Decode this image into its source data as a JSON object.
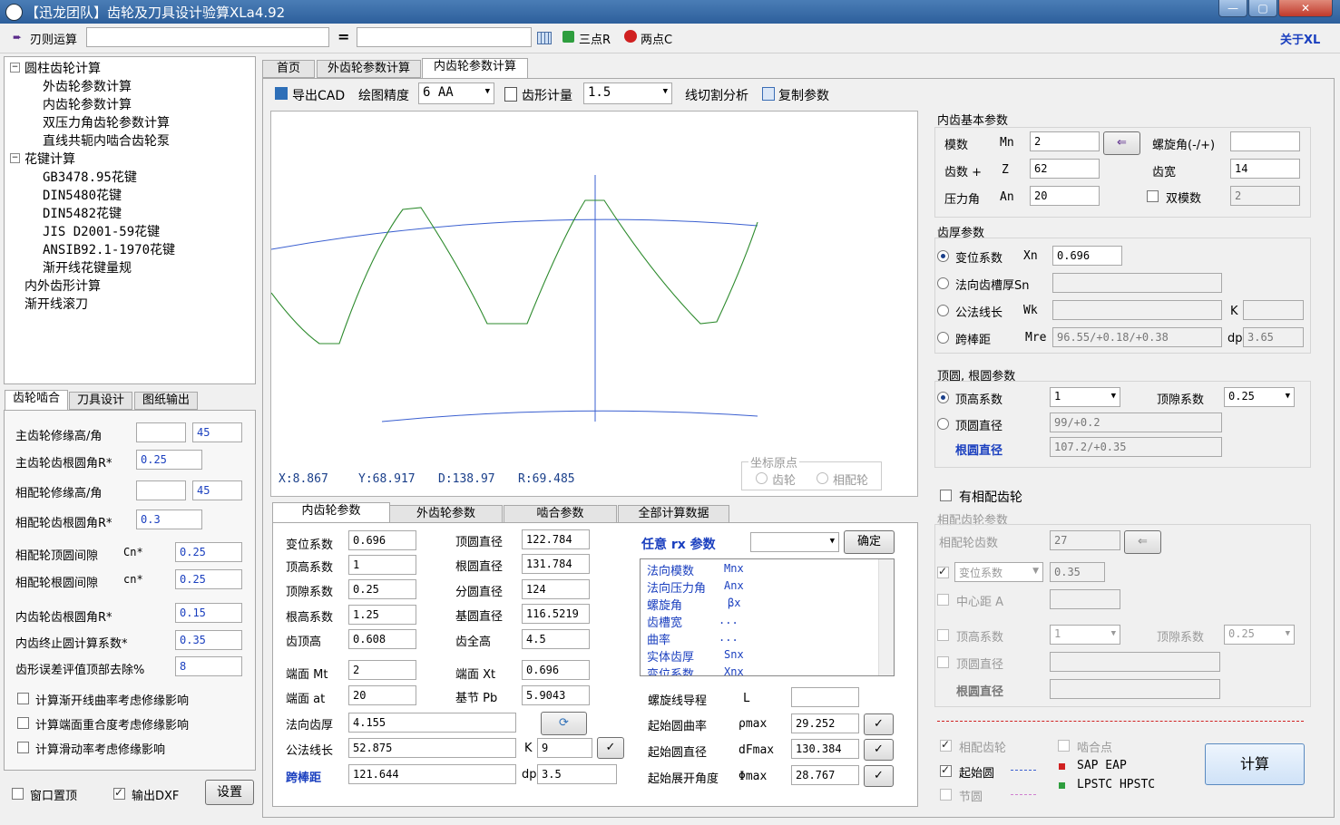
{
  "title": "【迅龙团队】齿轮及刀具设计验算XLa4.92",
  "window_buttons": {
    "min": "—",
    "max": "▢",
    "close": "✕"
  },
  "toolbar": {
    "rule_calc_label": "刃则运算",
    "eq": "=",
    "three_point": "三点R",
    "two_point": "两点C",
    "about": "关于XL"
  },
  "tree": {
    "items": [
      "圆柱齿轮计算",
      "外齿轮参数计算",
      "内齿轮参数计算",
      "双压力角齿轮参数计算",
      "直线共轭内啮合齿轮泵",
      "花键计算",
      "GB3478.95花键",
      "DIN5480花键",
      "DIN5482花键",
      "JIS D2001-59花键",
      "ANSIB92.1-1970花键",
      "渐开线花键量规",
      "内外齿形计算",
      "渐开线滚刀"
    ]
  },
  "left_tabs": [
    "齿轮啮合",
    "刀具设计",
    "图纸输出"
  ],
  "left_form": {
    "rows": [
      {
        "label": "主齿轮修缘高/角",
        "v1": "",
        "v2": "45"
      },
      {
        "label": "主齿轮齿根圆角R*",
        "v1": "0.25"
      },
      {
        "label": "相配轮修缘高/角",
        "v1": "",
        "v2": "45"
      },
      {
        "label": "相配轮齿根圆角R*",
        "v1": "0.3"
      },
      {
        "label": "相配轮顶圆间隙",
        "sym": "Cn*",
        "v1": "0.25"
      },
      {
        "label": "相配轮根圆间隙",
        "sym": "cn*",
        "v1": "0.25"
      },
      {
        "label": "内齿轮齿根圆角R*",
        "v1": "0.15"
      },
      {
        "label": "内齿终止圆计算系数*",
        "v1": "0.35"
      },
      {
        "label": "齿形误差评值顶部去除%",
        "v1": "8"
      }
    ],
    "checks": [
      "计算渐开线曲率考虑修缘影响",
      "计算端面重合度考虑修缘影响",
      "计算滑动率考虑修缘影响"
    ],
    "bottom": {
      "topmost": "窗口置顶",
      "dxf": "输出DXF",
      "settings": "设置"
    }
  },
  "main_tabs": [
    "首页",
    "外齿轮参数计算",
    "内齿轮参数计算"
  ],
  "drawbar": {
    "export_cad": "导出CAD",
    "precision_label": "绘图精度",
    "precision_value": "6  AA",
    "gauge_label": "齿形计量",
    "gauge_value": "1.5",
    "wire_cut": "线切割分析",
    "copy_params": "复制参数"
  },
  "canvas": {
    "x": "X:8.867",
    "y": "Y:68.917",
    "d": "D:138.97",
    "r": "R:69.485",
    "origin_title": "坐标原点",
    "origin_gear": "齿轮",
    "origin_mate": "相配轮"
  },
  "bottom_tabs": [
    "内齿轮参数",
    "外齿轮参数",
    "啮合参数",
    "全部计算数据"
  ],
  "inner_params": {
    "col1": [
      {
        "label": "变位系数",
        "value": "0.696"
      },
      {
        "label": "顶高系数",
        "value": "1"
      },
      {
        "label": "顶隙系数",
        "value": "0.25"
      },
      {
        "label": "根高系数",
        "value": "1.25"
      },
      {
        "label": "齿顶高",
        "value": "0.608"
      },
      {
        "label": "端面 Mt",
        "value": "2"
      },
      {
        "label": "端面 at",
        "value": "20"
      }
    ],
    "col2": [
      {
        "label": "顶圆直径",
        "value": "122.784"
      },
      {
        "label": "根圆直径",
        "value": "131.784"
      },
      {
        "label": "分圆直径",
        "value": "124"
      },
      {
        "label": "基圆直径",
        "value": "116.5219"
      },
      {
        "label": "齿全高",
        "value": "4.5"
      },
      {
        "label": "端面 Xt",
        "value": "0.696"
      },
      {
        "label": "基节 Pb",
        "value": "5.9043"
      }
    ],
    "normal_thickness_label": "法向齿厚",
    "normal_thickness": "4.155",
    "wk_label": "公法线长",
    "wk": "52.875",
    "k_label": "K",
    "k": "9",
    "ball_label": "跨棒距",
    "ball": "121.644",
    "dp_label": "dp",
    "dp": "3.5",
    "rx_title": "任意 rx 参数",
    "confirm": "确定",
    "rx_list": [
      {
        "n": "法向模数",
        "s": "Mnx"
      },
      {
        "n": "法向压力角",
        "s": "Anx"
      },
      {
        "n": "螺旋角",
        "s": "βx"
      },
      {
        "n": "齿槽宽",
        "s": "..."
      },
      {
        "n": "曲率",
        "s": "..."
      },
      {
        "n": "实体齿厚",
        "s": "Snx"
      },
      {
        "n": "变位系数",
        "s": "Xnx"
      }
    ],
    "lead_label": "螺旋线导程",
    "lead_sym": "L",
    "lead": "",
    "rho_label": "起始圆曲率",
    "rho_sym": "ρmax",
    "rho": "29.252",
    "dia_label": "起始圆直径",
    "dia_sym": "dFmax",
    "dia": "130.384",
    "ang_label": "起始展开角度",
    "ang_sym": "Φmax",
    "ang": "28.767"
  },
  "right": {
    "basic_title": "内齿基本参数",
    "module_label": "模数",
    "module_sym": "Mn",
    "module": "2",
    "helix_label": "螺旋角(-/+)",
    "helix": "",
    "teeth_label": "齿数 +",
    "teeth_sym": "Z",
    "teeth": "62",
    "width_label": "齿宽",
    "width": "14",
    "pa_label": "压力角",
    "pa_sym": "An",
    "pa": "20",
    "dual_label": "双模数",
    "dual": "2",
    "thick_title": "齿厚参数",
    "xn_label": "变位系数",
    "xn_sym": "Xn",
    "xn": "0.696",
    "sn_label": "法向齿槽厚Sn",
    "sn": "",
    "wk_label": "公法线长",
    "wk_sym": "Wk",
    "wk": "",
    "k_label": "K",
    "k": "",
    "mre_label": "跨棒距",
    "mre_sym": "Mre",
    "mre": "96.55/+0.18/+0.38",
    "dp_label": "dp",
    "dp": "3.65",
    "tip_title": "顶圆, 根圆参数",
    "ha_label": "顶高系数",
    "ha": "1",
    "c_label": "顶隙系数",
    "c": "0.25",
    "da_label": "顶圆直径",
    "da": "99/+0.2",
    "df_label": "根圆直径",
    "df": "107.2/+0.35",
    "mate_check": "有相配齿轮",
    "mate_title": "相配齿轮参数",
    "mate_teeth_label": "相配轮齿数",
    "mate_teeth": "27",
    "mate_xn_label": "变位系数",
    "mate_xn": "0.35",
    "center_label": "中心距 A",
    "center": "",
    "mate_ha_label": "顶高系数",
    "mate_ha": "1",
    "mate_c_label": "顶隙系数",
    "mate_c": "0.25",
    "mate_da_label": "顶圆直径",
    "mate_da": "",
    "mate_df_label": "根圆直径",
    "mate_df": "",
    "legend_mate": "相配齿轮",
    "legend_start": "起始圆",
    "legend_pitch": "节圆",
    "legend_mesh": "啮合点",
    "legend_sap": "SAP EAP",
    "legend_lpstc": "LPSTC HPSTC",
    "calc": "计算"
  },
  "colors": {
    "tooth": "#2e8b2e",
    "circle": "#3a5fd0",
    "accent": "#1a3fbf"
  }
}
